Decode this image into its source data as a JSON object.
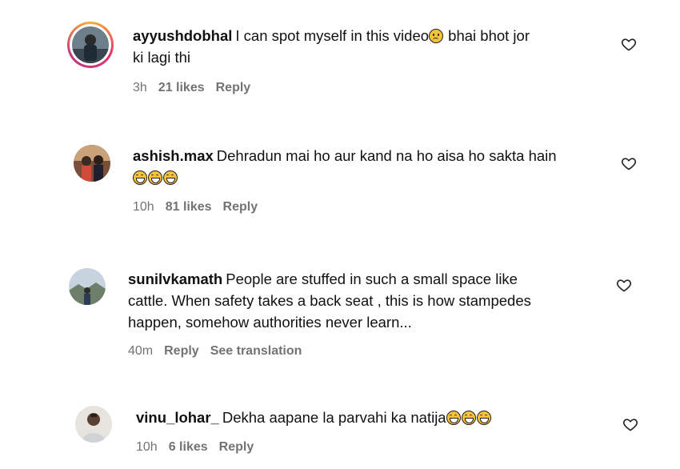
{
  "comments": [
    {
      "username": "ayyushdobhal",
      "line1": "I can spot myself in this video",
      "line1_after": " bhai bhot jor",
      "line2": "ki lagi thi",
      "time": "3h",
      "likes": "21 likes",
      "reply": "Reply",
      "emoji": "sad-face-icon"
    },
    {
      "username": "ashish.max",
      "line1": "Dehradun mai ho aur kand na ho aisa ho sakta hain",
      "time": "10h",
      "likes": "81 likes",
      "reply": "Reply",
      "emoji": "laughing-face-icon"
    },
    {
      "username": "sunilvkamath",
      "line1": "People are stuffed in such a small space like",
      "line2": "cattle. When safety takes a back seat , this is how stampedes",
      "line3": "happen, somehow authorities never learn...",
      "time": "40m",
      "reply": "Reply",
      "translate": "See translation"
    },
    {
      "username": "vinu_lohar_",
      "line1": "Dekha aapane la parvahi ka natija",
      "time": "10h",
      "likes": "6 likes",
      "reply": "Reply",
      "emoji": "laughing-face-icon"
    }
  ],
  "colors": {
    "meta": "#737373",
    "text": "#111111",
    "emoji": "#f5c33b"
  }
}
